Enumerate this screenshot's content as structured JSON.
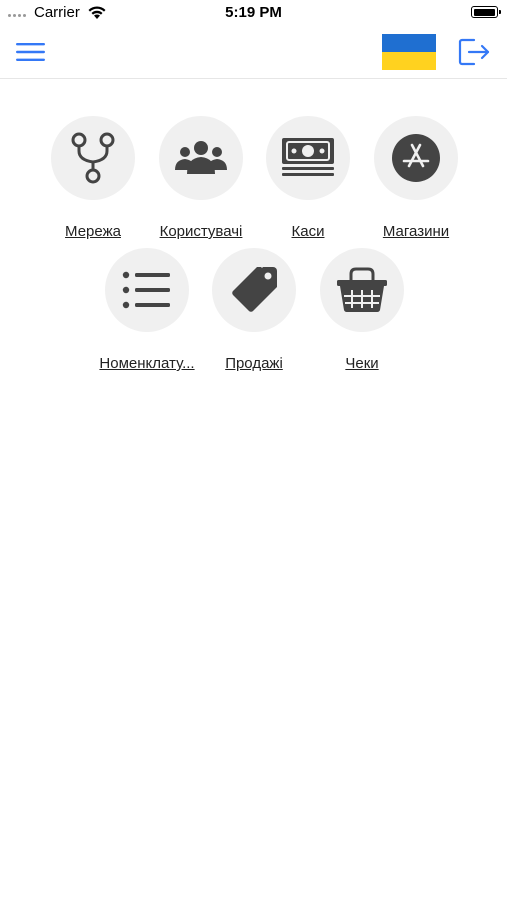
{
  "status_bar": {
    "carrier": "Carrier",
    "time": "5:19 PM",
    "battery_level": 1.0
  },
  "nav": {
    "menu_icon": "hamburger-menu-icon",
    "flag_icon": "ukraine-flag-icon",
    "logout_icon": "logout-icon",
    "flag_colors": [
      "#1F6FD1",
      "#FFD21F"
    ],
    "accent_color": "#3478F6"
  },
  "tiles": [
    {
      "label": "Мережа",
      "icon": "network-branch-icon"
    },
    {
      "label": "Користувачі",
      "icon": "users-group-icon"
    },
    {
      "label": "Каси",
      "icon": "cash-register-money-icon"
    },
    {
      "label": "Магазини",
      "icon": "app-store-icon"
    },
    {
      "label": "Номенклату...",
      "icon": "list-icon"
    },
    {
      "label": "Продажі",
      "icon": "price-tags-icon"
    },
    {
      "label": "Чеки",
      "icon": "shopping-basket-icon"
    }
  ]
}
